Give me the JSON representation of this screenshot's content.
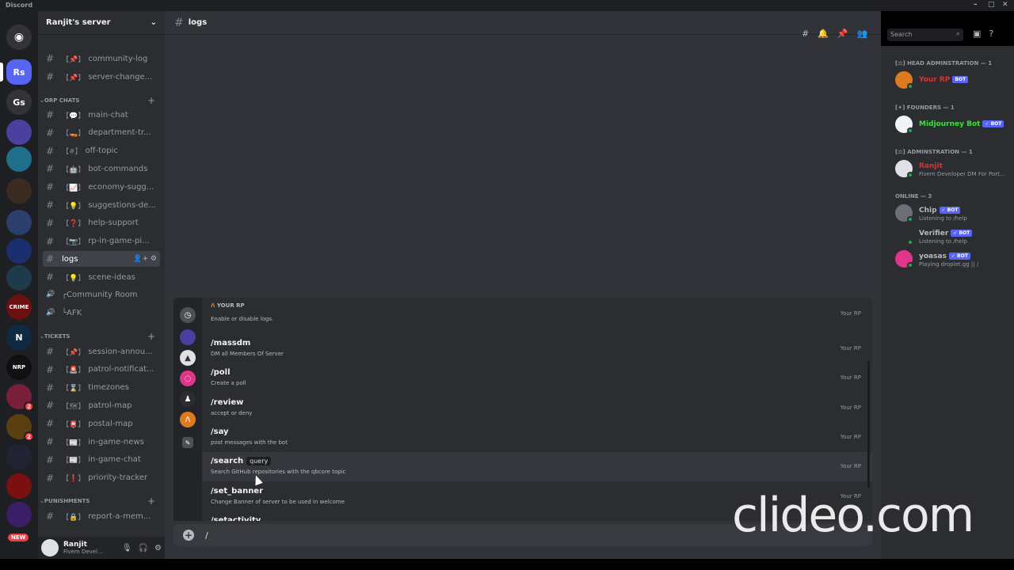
{
  "window": {
    "app": "Discord",
    "controls": [
      "–",
      "□",
      "✕"
    ]
  },
  "rail": {
    "guilds": [
      {
        "label": "",
        "icon": "discord-home-icon",
        "color": "#313338"
      },
      {
        "label": "Rs",
        "color": "#5865f2"
      },
      {
        "label": "Gs",
        "color": "#313338"
      },
      {
        "label": "",
        "color": "#4b3fa0"
      },
      {
        "label": "",
        "color": "#1f6f8b"
      },
      {
        "label": "",
        "color": "#3a2a22"
      },
      {
        "label": "",
        "color": "#2c3e6b"
      },
      {
        "label": "",
        "color": "#1b2f6e"
      },
      {
        "label": "",
        "color": "#1d3b4a"
      },
      {
        "label": "CRIME",
        "color": "#6b0f0f"
      },
      {
        "label": "N",
        "color": "#0f2a44"
      },
      {
        "label": "NRP",
        "color": "#111111"
      },
      {
        "label": "",
        "color": "#7a1f3a",
        "badge": "2"
      },
      {
        "label": "",
        "color": "#5a4010",
        "badge": "2"
      },
      {
        "label": "",
        "color": "#222233"
      },
      {
        "label": "",
        "color": "#7a1010"
      },
      {
        "label": "",
        "color": "#3b1f66"
      }
    ],
    "new_badge": "NEW"
  },
  "sidebar": {
    "server_name": "Ranjit's server",
    "channels_top": [
      {
        "deco": "【📌】",
        "name": "community-log"
      },
      {
        "deco": "【📌】",
        "name": "server-change..."
      }
    ],
    "cat1": "ORP CHATS",
    "channels_orp": [
      {
        "deco": "【💬】",
        "name": "main-chat"
      },
      {
        "deco": "【🚤】",
        "name": "department-tr..."
      },
      {
        "deco": "【#】",
        "name": "off-topic"
      },
      {
        "deco": "【🤖】",
        "name": "bot-commands"
      },
      {
        "deco": "【📈】",
        "name": "economy-sugg..."
      },
      {
        "deco": "【💡】",
        "name": "suggestions-de..."
      },
      {
        "deco": "【❓】",
        "name": "help-support"
      },
      {
        "deco": "【📷】",
        "name": "rp-in-game-pi..."
      }
    ],
    "selected": "logs",
    "channels_after": [
      {
        "deco": "【💡】",
        "name": "scene-ideas"
      }
    ],
    "voice": [
      "┌Community Room",
      "└AFK"
    ],
    "cat2": "TICKETS",
    "channels_tickets": [
      {
        "deco": "【📌】",
        "name": "session-annou..."
      },
      {
        "deco": "【🚨】",
        "name": "patrol-notificat..."
      },
      {
        "deco": "【⌛】",
        "name": "timezones"
      },
      {
        "deco": "【🗺】",
        "name": "patrol-map"
      },
      {
        "deco": "【📮】",
        "name": "postal-map"
      },
      {
        "deco": "【📰】",
        "name": "in-game-news"
      },
      {
        "deco": "【📰】",
        "name": "in-game-chat"
      },
      {
        "deco": "【❗】",
        "name": "priority-tracker"
      }
    ],
    "cat3": "PUNISHMENTS",
    "channels_pun": [
      {
        "deco": "【🔒】",
        "name": "report-a-mem..."
      }
    ],
    "user": {
      "name": "Ranjit",
      "status": "Fivem Devel..."
    }
  },
  "header": {
    "channel": "logs",
    "search_placeholder": "Search"
  },
  "picker": {
    "category": "YOUR RP",
    "commands": [
      {
        "name": "",
        "desc": "Enable or disable logs.",
        "src": "Your RP"
      },
      {
        "name": "/massdm",
        "desc": "DM all Members Of Server",
        "src": "Your RP"
      },
      {
        "name": "/poll",
        "desc": "Create a poll",
        "src": "Your RP"
      },
      {
        "name": "/review",
        "desc": "accept or deny",
        "src": "Your RP"
      },
      {
        "name": "/say",
        "desc": "post messages with the bot",
        "src": "Your RP"
      },
      {
        "name": "/search",
        "opt": "query",
        "desc": "Search GitHub repositories with the qbcore topic",
        "src": "Your RP"
      },
      {
        "name": "/set_banner",
        "desc": "Change Banner of server to be used in welcome",
        "src": "Your RP"
      },
      {
        "name": "/setactivity",
        "desc": "",
        "src": ""
      }
    ]
  },
  "composer": {
    "value": "/"
  },
  "members": {
    "groups": [
      {
        "title": "[⚖] HEAD ADMINSTRATION — 1",
        "items": [
          {
            "name": "Your RP",
            "tag": "BOT",
            "color": "#e03030",
            "activity": "",
            "av": "#e07a1f"
          }
        ]
      },
      {
        "title": "[✦] FOUNDERS — 1",
        "items": [
          {
            "name": "Midjourney Bot",
            "tag": "✓ BOT",
            "color": "#3ee03e",
            "activity": "",
            "av": "#f2f3f5"
          }
        ]
      },
      {
        "title": "[⚖] ADMINSTRATION — 1",
        "items": [
          {
            "name": "Ranjit",
            "tag": "",
            "color": "#e03030",
            "activity": "Fivem Developer DM For Port...",
            "av": "#dfe1e5"
          }
        ]
      },
      {
        "title": "ONLINE — 3",
        "items": [
          {
            "name": "Chip",
            "tag": "✓ BOT",
            "color": "#b5bac1",
            "activity": "Listening to /help",
            "av": "#6b6f78"
          },
          {
            "name": "Verifier",
            "tag": "✓ BOT",
            "color": "#b5bac1",
            "activity": "Listening to /help",
            "av": "#2b2d31"
          },
          {
            "name": "yoasas",
            "tag": "✓ BOT",
            "color": "#b5bac1",
            "activity": "Playing droplet.gg || /",
            "av": "#e0368a"
          }
        ]
      }
    ]
  },
  "watermark": "clideo.com"
}
